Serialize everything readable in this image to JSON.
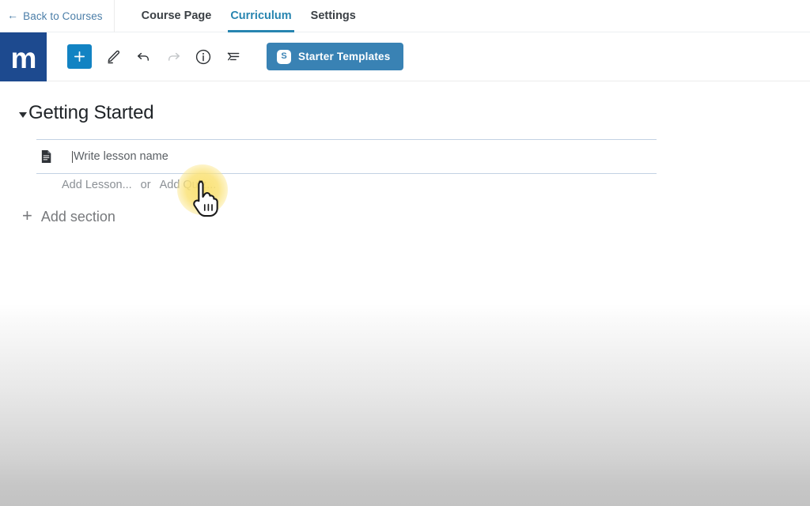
{
  "topbar": {
    "back_label": "Back to Courses",
    "back_icon": "arrow-left-icon",
    "tabs": [
      {
        "label": "Course Page",
        "active": false
      },
      {
        "label": "Curriculum",
        "active": true
      },
      {
        "label": "Settings",
        "active": false
      }
    ]
  },
  "toolbar": {
    "logo_text": "m",
    "logo_color": "#1d4a8f",
    "add_block_label": "+",
    "add_block_color": "#1283c3",
    "icons": [
      {
        "name": "pencil-icon",
        "enabled": true
      },
      {
        "name": "undo-icon",
        "enabled": true
      },
      {
        "name": "redo-icon",
        "enabled": false
      },
      {
        "name": "info-icon",
        "enabled": true
      },
      {
        "name": "document-outline-icon",
        "enabled": true
      }
    ],
    "starter_templates": {
      "label": "Starter Templates",
      "badge": "S",
      "color": "#3982b4"
    }
  },
  "curriculum": {
    "section": {
      "title": "Getting Started",
      "expanded": true,
      "caret_icon": "caret-down-icon"
    },
    "lesson": {
      "icon": "file-document-icon",
      "placeholder": "Write lesson name",
      "value": ""
    },
    "actions": {
      "add_lesson": "Add Lesson...",
      "separator": "or",
      "add_quiz": "Add Quiz..."
    },
    "add_section": {
      "icon": "plus-icon",
      "label": "Add section"
    }
  },
  "cursor": {
    "icon": "hand-pointer-cursor",
    "highlight_color": "#fae06e"
  }
}
